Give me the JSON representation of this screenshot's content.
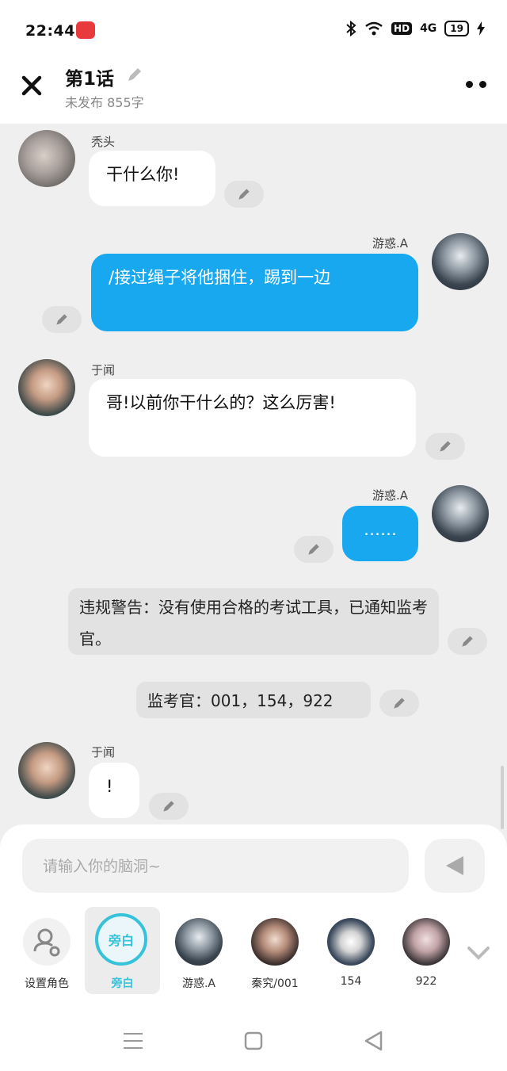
{
  "status": {
    "time": "22:44",
    "hd": "HD",
    "network": "4G",
    "battery": "19"
  },
  "header": {
    "title": "第1话",
    "subtitle": "未发布 855字"
  },
  "messages": [
    {
      "sender": "秃头",
      "text": "干什么你!"
    },
    {
      "sender": "游惑.A",
      "text": "/接过绳子将他捆住，踢到一边"
    },
    {
      "sender": "于闻",
      "text": "哥!以前你干什么的？这么厉害!"
    },
    {
      "sender": "游惑.A",
      "text": "……"
    },
    {
      "notice": "违规警告：没有使用合格的考试工具，已通知监考官。"
    },
    {
      "notice": "监考官：001，154，922"
    },
    {
      "sender": "于闻",
      "text": "!"
    }
  ],
  "composer": {
    "placeholder": "请输入你的脑洞~"
  },
  "roles": [
    {
      "label": "设置角色"
    },
    {
      "label": "旁白",
      "circle_text": "旁白"
    },
    {
      "label": "游惑.A"
    },
    {
      "label": "秦究/001"
    },
    {
      "label": "154"
    },
    {
      "label": "922"
    }
  ],
  "colors": {
    "accent": "#17a8f0",
    "narration": "#36c3da"
  }
}
